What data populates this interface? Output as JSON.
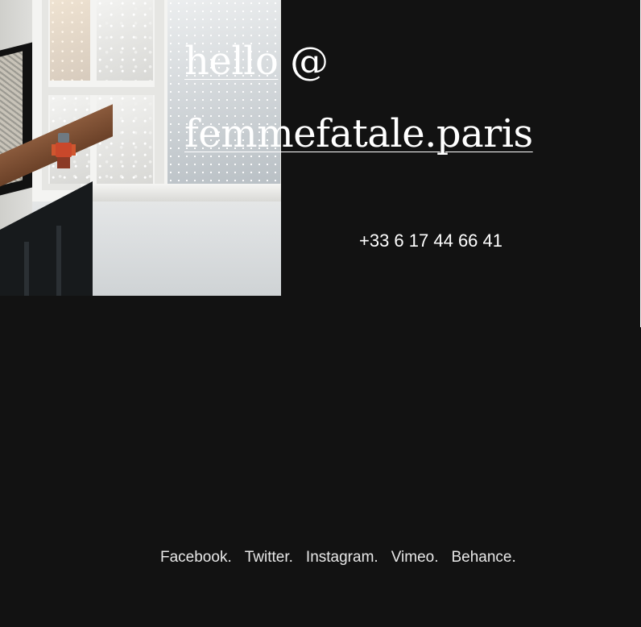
{
  "contact": {
    "email_part1": "hello",
    "email_at": " @",
    "email_part2": "femmefatale.paris",
    "phone": "+33 6 17 44 66 41"
  },
  "social": {
    "links": [
      {
        "label": "Facebook."
      },
      {
        "label": "Twitter."
      },
      {
        "label": "Instagram."
      },
      {
        "label": "Vimeo."
      },
      {
        "label": "Behance."
      }
    ]
  },
  "colors": {
    "background": "#121212",
    "text": "#ffffff"
  }
}
